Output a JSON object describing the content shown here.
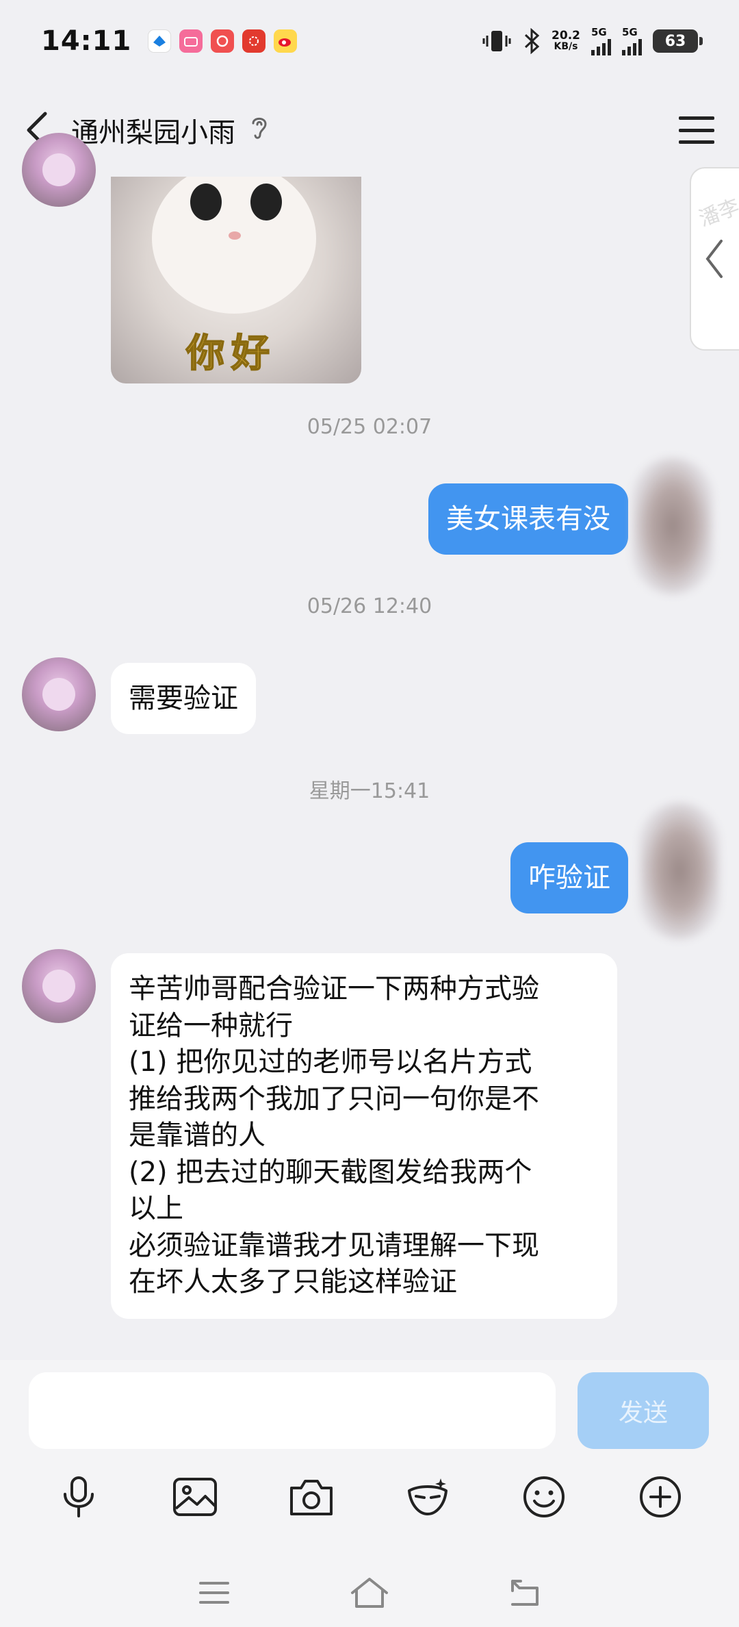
{
  "status_bar": {
    "time": "14:11",
    "net_speed_value": "20.2",
    "net_speed_unit": "KB/s",
    "signal1_label": "5G",
    "signal2_label": "5G",
    "battery": "63"
  },
  "header": {
    "title": "通州梨园小雨"
  },
  "side_tab": {
    "ghost_text": "潘李"
  },
  "messages": {
    "sticker_text": "你好",
    "ts1": "05/25 02:07",
    "out1": "美女课表有没",
    "ts2": "05/26 12:40",
    "in1": "需要验证",
    "ts3": "星期一15:41",
    "out2": "咋验证",
    "in2_lines": [
      "辛苦帅哥配合验证一下两种方式验",
      "证给一种就行",
      "(1) 把你见过的老师号以名片方式",
      "推给我两个我加了只问一句你是不",
      "是靠谱的人",
      "(2) 把去过的聊天截图发给我两个",
      "以上",
      "必须验证靠谱我才见请理解一下现",
      "在坏人太多了只能这样验证"
    ]
  },
  "input": {
    "placeholder": "",
    "send_label": "发送"
  },
  "colors": {
    "accent": "#4295f0",
    "send_disabled": "#a5cff6",
    "background": "#f0f0f3"
  }
}
